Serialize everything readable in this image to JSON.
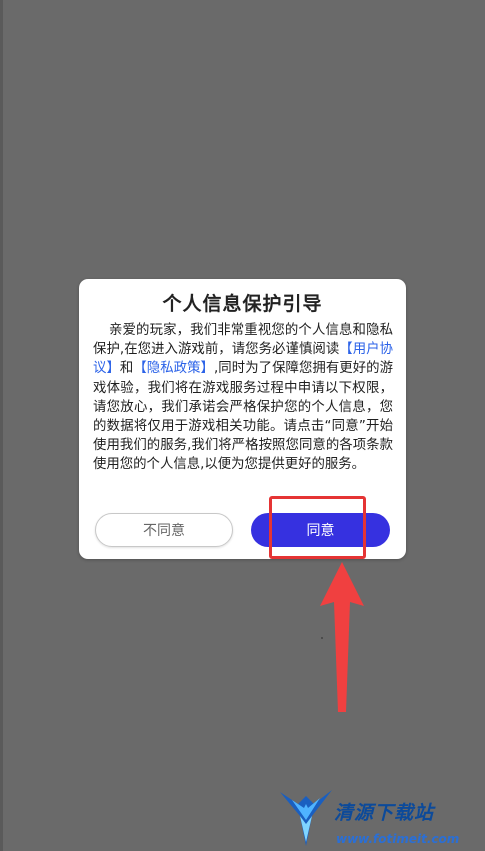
{
  "dialog": {
    "title": "个人信息保护引导",
    "body_part1": "亲爱的玩家，我们非常重视您的个人信息和隐私保护,在您进入游戏前，请您务必谨慎阅读",
    "user_agreement_link": "【用户协议】",
    "body_and": "和",
    "privacy_policy_link": "【隐私政策】",
    "body_part2": ",同时为了保障您拥有更好的游戏体验，我们将在游戏服务过程中申请以下权限，请您放心，我们承诺会严格保护您的个人信息，您的数据将仅用于游戏相关功能。请点击“同意”开始使用我们的服务,我们将严格按照您同意的各项条款使用您的个人信息,以便为您提供更好的服务。",
    "disagree_label": "不同意",
    "agree_label": "同意"
  },
  "annotation": {
    "highlight_color": "#e53434",
    "arrow_color": "#f04040"
  },
  "watermark": {
    "title": "清源下载站",
    "url": "www.fotimeit.com"
  },
  "colors": {
    "overlay": "#6a6a6a",
    "dialog_bg": "#ffffff",
    "link": "#2b62e8",
    "agree_button": "#3631e0"
  }
}
